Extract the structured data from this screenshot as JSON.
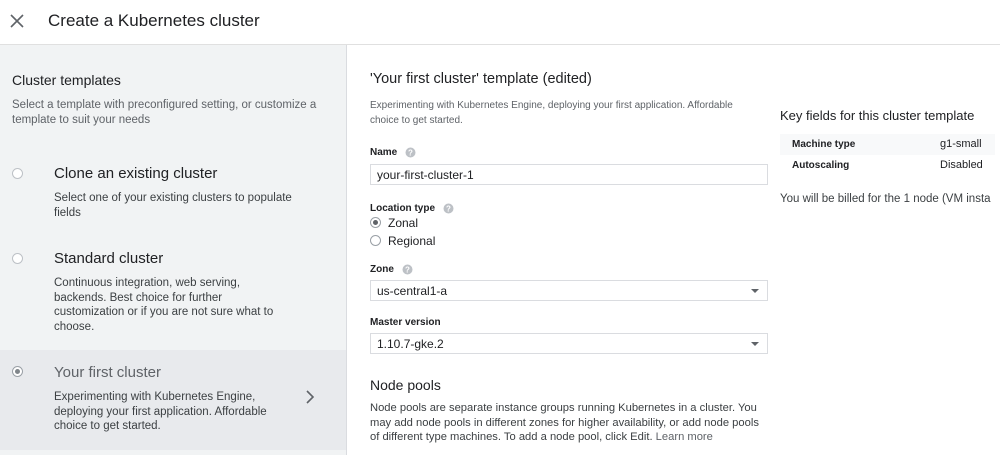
{
  "header": {
    "title": "Create a Kubernetes cluster"
  },
  "templates_panel": {
    "title": "Cluster templates",
    "description": "Select a template with preconfigured setting, or customize a template to suit your needs",
    "items": [
      {
        "title": "Clone an existing cluster",
        "description": "Select one of your existing clusters to populate fields",
        "selected": false
      },
      {
        "title": "Standard cluster",
        "description": "Continuous integration, web serving, backends. Best choice for further customization or if you are not sure what to choose.",
        "selected": false
      },
      {
        "title": "Your first cluster",
        "description": "Experimenting with Kubernetes Engine, deploying your first application. Affordable choice to get started.",
        "selected": true
      }
    ]
  },
  "form": {
    "title": "'Your first cluster' template (edited)",
    "description": "Experimenting with Kubernetes Engine, deploying your first application. Affordable choice to get started.",
    "name": {
      "label": "Name",
      "value": "your-first-cluster-1"
    },
    "location_type": {
      "label": "Location type",
      "options": [
        "Zonal",
        "Regional"
      ],
      "selected": "Zonal"
    },
    "zone": {
      "label": "Zone",
      "value": "us-central1-a"
    },
    "master_version": {
      "label": "Master version",
      "value": "1.10.7-gke.2"
    },
    "node_pools": {
      "title": "Node pools",
      "description": "Node pools are separate instance groups running Kubernetes in a cluster. You may add node pools in different zones for higher availability, or add node pools of different type machines. To add a node pool, click Edit.",
      "learn_more": "Learn more"
    }
  },
  "key_fields": {
    "title": "Key fields for this cluster template",
    "rows": [
      {
        "key": "Machine type",
        "value": "g1-small"
      },
      {
        "key": "Autoscaling",
        "value": "Disabled"
      }
    ],
    "billing": "You will be billed for the 1 node (VM insta"
  },
  "colors": {
    "left_panel_bg": "#f1f3f4",
    "selected_bg": "#e8eaed",
    "border": "#dadce0"
  }
}
